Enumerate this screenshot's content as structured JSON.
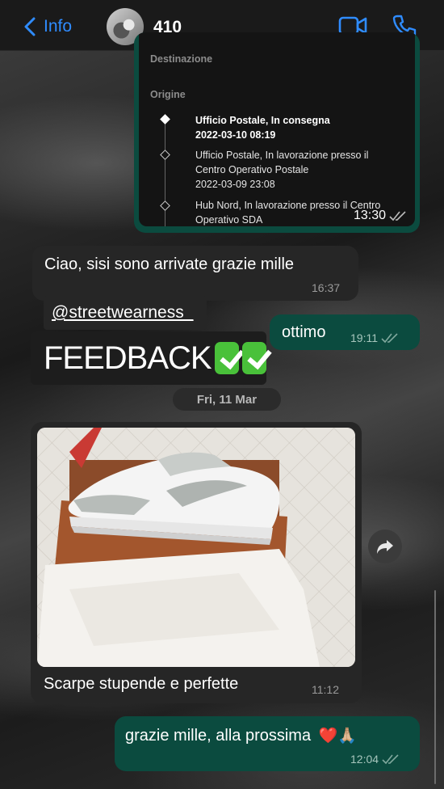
{
  "header": {
    "back_label": "Info",
    "contact_name": "410"
  },
  "tracking": {
    "destination_label": "Destinazione",
    "origin_label": "Origine",
    "events": [
      {
        "line1": "Ufficio Postale, In consegna",
        "line2": "2022-03-10 08:19",
        "line3": ""
      },
      {
        "line1": "Ufficio Postale, In lavorazione presso il",
        "line2": "Centro Operativo Postale",
        "line3": "2022-03-09 23:08"
      },
      {
        "line1": "Hub Nord, In lavorazione presso il Centro",
        "line2": "Operativo SDA",
        "line3": ""
      }
    ],
    "time": "13:30"
  },
  "messages": {
    "ciao": {
      "text": "Ciao, sisi sono arrivate grazie mille",
      "time": "16:37"
    },
    "ottimo": {
      "text": "ottimo",
      "time": "19:11"
    },
    "sticker_handle": "@streetwearness_",
    "sticker_text": "FEEDBACK",
    "date_divider": "Fri, 11 Mar",
    "photo_caption": {
      "text": "Scarpe stupende e perfette",
      "time": "11:12"
    },
    "last": {
      "text": "grazie mille, alla prossima",
      "emoji": "❤️🙏🏼",
      "time": "12:04"
    }
  },
  "colors": {
    "accent": "#2f8cff",
    "outgoing_bubble": "#0b4b3f",
    "incoming_bubble": "#262626"
  }
}
